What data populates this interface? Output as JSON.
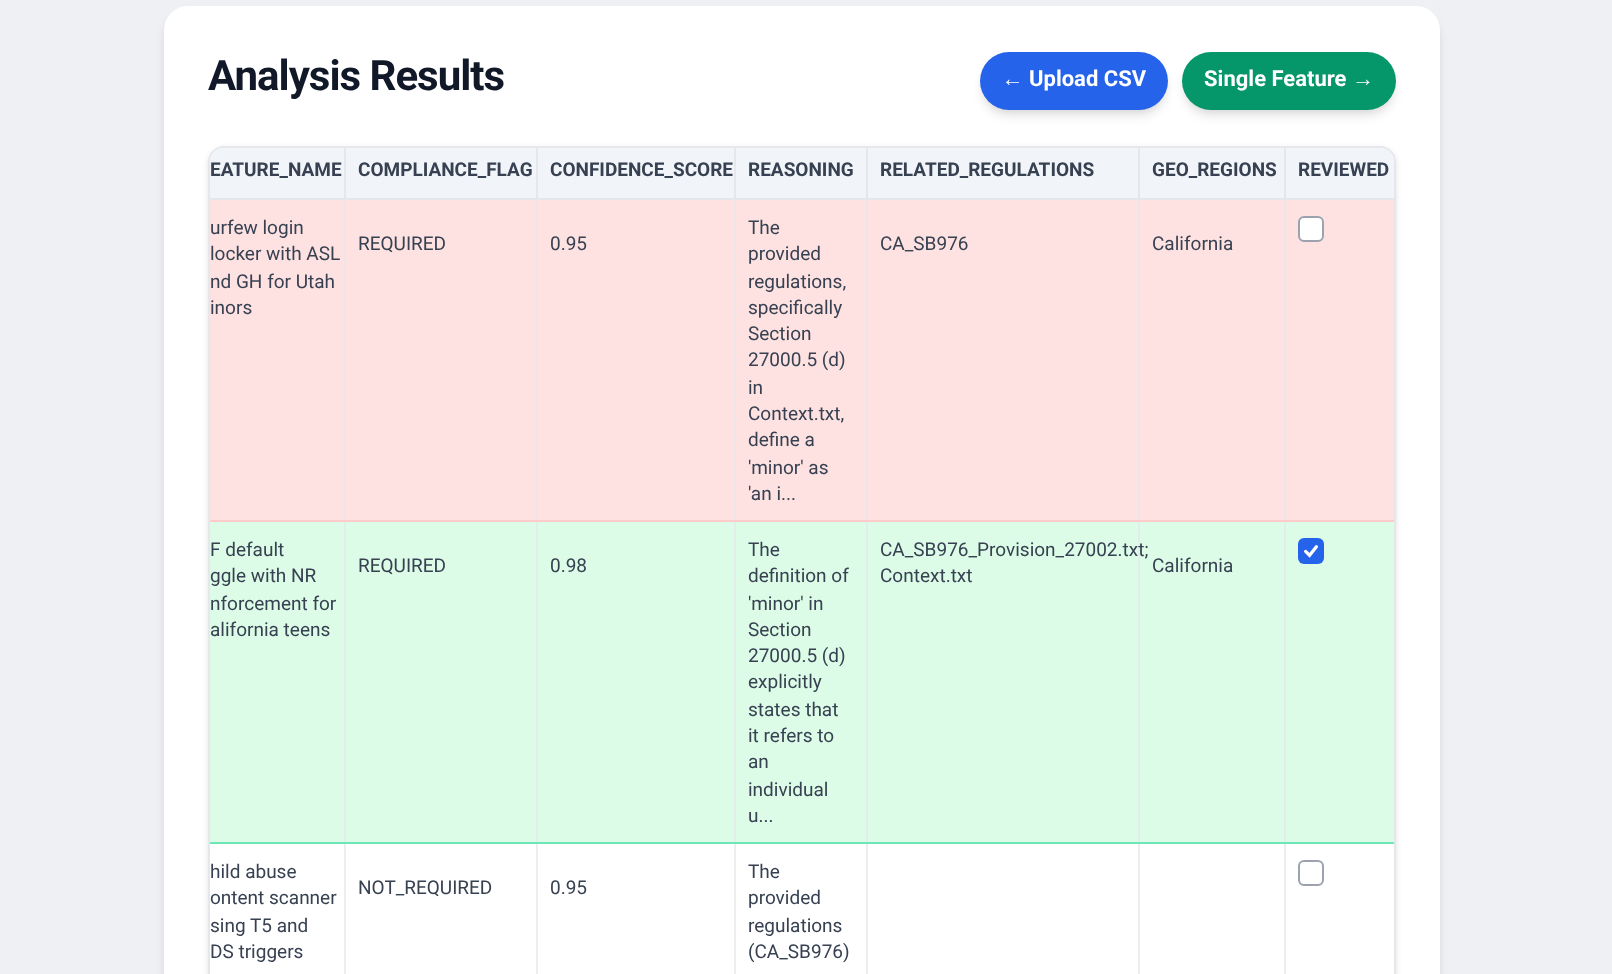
{
  "title": "Analysis Results",
  "buttons": [
    {
      "label": "← Upload CSV",
      "kind": "back"
    },
    {
      "label": "Single Feature →",
      "kind": "forward"
    }
  ],
  "table": {
    "columns": [
      "EATURE_NAME",
      "COMPLIANCE_FLAG",
      "CONFIDENCE_SCORE",
      "REASONING",
      "RELATED_REGULATIONS",
      "GEO_REGIONS",
      "REVIEWED"
    ],
    "rows": [
      {
        "kind": "flagged",
        "feature_name": "urfew login\nlocker with ASL\nnd GH for Utah\ninors",
        "compliance_flag": "REQUIRED",
        "confidence_score": "0.95",
        "reasoning": "The\nprovided\nregulations,\nspecifically\nSection\n27000.5 (d)\nin\nContext.txt,\ndefine a\n'minor' as\n'an i...",
        "related_regulations": "CA_SB976",
        "geo_regions": "California",
        "reviewed": false
      },
      {
        "kind": "reviewed",
        "feature_name": "F default\nggle with NR\nnforcement for\nalifornia teens",
        "compliance_flag": "REQUIRED",
        "confidence_score": "0.98",
        "reasoning": "The\ndefinition of\n'minor' in\nSection\n27000.5 (d)\nexplicitly\nstates that\nit refers to\nan\nindividual\nu...",
        "related_regulations": "CA_SB976_Provision_27002.txt;\nContext.txt",
        "geo_regions": "California",
        "reviewed": true
      },
      {
        "kind": "plain",
        "feature_name": "hild abuse\nontent scanner\nsing T5 and\nDS triggers",
        "compliance_flag": "NOT_REQUIRED",
        "confidence_score": "0.95",
        "reasoning": "The\nprovided\nregulations\n(CA_SB976)",
        "reviewed": false
      }
    ]
  }
}
